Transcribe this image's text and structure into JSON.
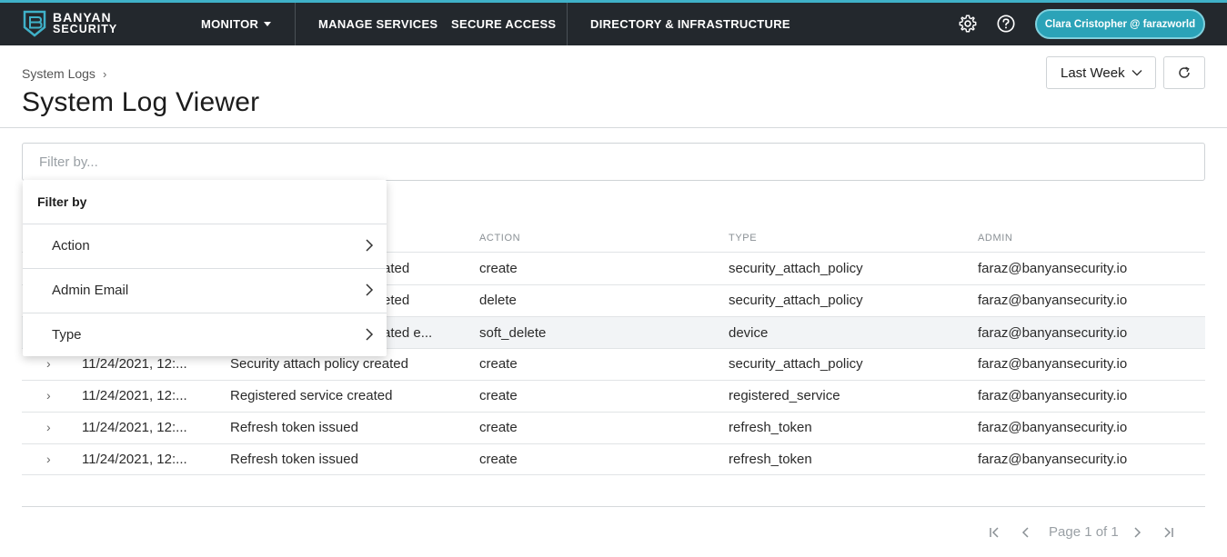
{
  "brand": {
    "line1": "BANYAN",
    "line2": "SECURITY"
  },
  "nav": {
    "monitor": "MONITOR",
    "manage_services": "MANAGE SERVICES",
    "secure_access": "SECURE ACCESS",
    "directory": "DIRECTORY & INFRASTRUCTURE"
  },
  "user": {
    "label": "Clara Cristopher @ farazworld"
  },
  "breadcrumb": {
    "label": "System Logs"
  },
  "page": {
    "title": "System Log Viewer"
  },
  "range": {
    "value": "Last Week"
  },
  "filter": {
    "placeholder": "Filter by..."
  },
  "filter_menu": {
    "title": "Filter by",
    "items": [
      "Action",
      "Admin Email",
      "Type"
    ]
  },
  "table": {
    "headers": {
      "action": "ACTION",
      "type": "TYPE",
      "admin": "ADMIN"
    },
    "rows": [
      {
        "date": "",
        "description": "ated",
        "action": "create",
        "type": "security_attach_policy",
        "admin": "faraz@banyansecurity.io"
      },
      {
        "date": "",
        "description": "eted",
        "action": "delete",
        "type": "security_attach_policy",
        "admin": "faraz@banyansecurity.io"
      },
      {
        "date": "",
        "description": "ated e...",
        "action": "soft_delete",
        "type": "device",
        "admin": "faraz@banyansecurity.io"
      },
      {
        "date": "11/24/2021, 12:...",
        "description": "Security attach policy created",
        "action": "create",
        "type": "security_attach_policy",
        "admin": "faraz@banyansecurity.io"
      },
      {
        "date": "11/24/2021, 12:...",
        "description": "Registered service created",
        "action": "create",
        "type": "registered_service",
        "admin": "faraz@banyansecurity.io"
      },
      {
        "date": "11/24/2021, 12:...",
        "description": "Refresh token issued",
        "action": "create",
        "type": "refresh_token",
        "admin": "faraz@banyansecurity.io"
      },
      {
        "date": "11/24/2021, 12:...",
        "description": "Refresh token issued",
        "action": "create",
        "type": "refresh_token",
        "admin": "faraz@banyansecurity.io"
      }
    ]
  },
  "pagination": {
    "label": "Page 1 of 1"
  },
  "colors": {
    "topbar": "#23282d",
    "accent": "#2ba3b8"
  }
}
